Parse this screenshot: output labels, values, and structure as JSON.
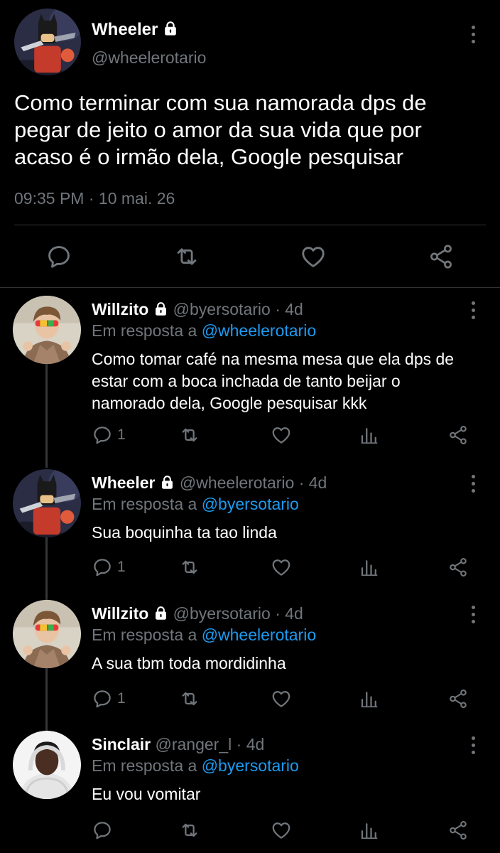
{
  "main_tweet": {
    "name": "Wheeler",
    "handle": "@wheelerotario",
    "text": "Como terminar com sua namorada dps de pegar de jeito o amor da sua vida que por acaso é o irmão dela, Google pesquisar",
    "time": "09:35 PM",
    "separator": "·",
    "date": "10 mai. 26"
  },
  "replies": [
    {
      "name": "Willzito",
      "handle": "@byersotario",
      "dot": "·",
      "age": "4d",
      "replying_prefix": "Em resposta a",
      "replying_to": "@wheelerotario",
      "text": "Como tomar café na mesma mesa que ela dps de estar com a boca inchada de tanto beijar o namorado dela, Google pesquisar kkk",
      "reply_count": "1"
    },
    {
      "name": "Wheeler",
      "handle": "@wheelerotario",
      "dot": "·",
      "age": "4d",
      "replying_prefix": "Em resposta a",
      "replying_to": "@byersotario",
      "text": "Sua boquinha ta tao linda",
      "reply_count": "1"
    },
    {
      "name": "Willzito",
      "handle": "@byersotario",
      "dot": "·",
      "age": "4d",
      "replying_prefix": "Em resposta a",
      "replying_to": "@wheelerotario",
      "text": "A sua tbm toda mordidinha",
      "reply_count": "1"
    },
    {
      "name": "Sinclair",
      "handle": "@ranger_l",
      "dot": "·",
      "age": "4d",
      "replying_prefix": "Em resposta a",
      "replying_to": "@byersotario",
      "text": "Eu vou vomitar",
      "reply_count": ""
    }
  ],
  "colors": {
    "background": "#000000",
    "text": "#e7e9ea",
    "muted": "#71767b",
    "link": "#1d9bf0",
    "divider": "#2f3336"
  },
  "icons": [
    "lock-icon",
    "more-icon",
    "reply-icon",
    "retweet-icon",
    "like-icon",
    "share-icon",
    "views-icon"
  ]
}
